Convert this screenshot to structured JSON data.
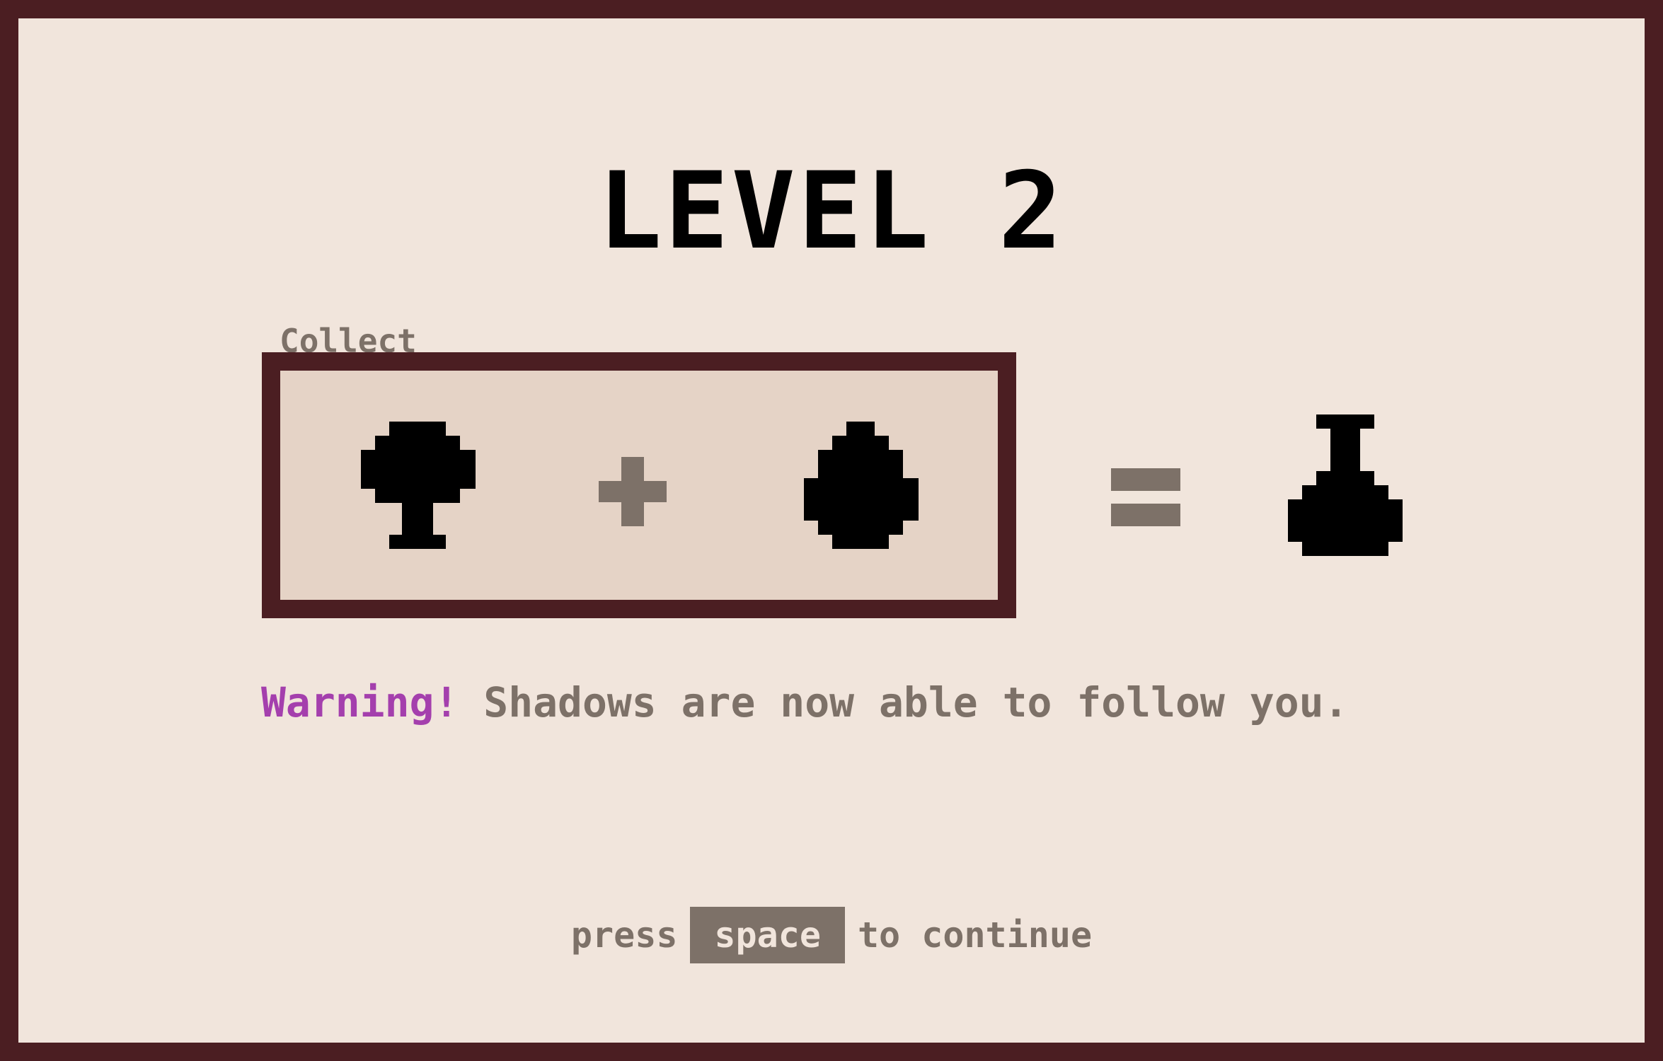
{
  "level": {
    "title": "LEVEL 2"
  },
  "recipe": {
    "label": "Collect",
    "ingredients": [
      "tree-icon",
      "egg-icon"
    ],
    "result": "potion-icon",
    "plus_symbol": "plus-icon",
    "equals_symbol": "equals-icon"
  },
  "warning": {
    "prefix": "Warning!",
    "message": "Shadows are now able to follow you."
  },
  "prompt": {
    "before": "press",
    "key": "space",
    "after": "to continue"
  },
  "colors": {
    "border": "#4b1e22",
    "background": "#f1e5dc",
    "box_fill": "#e5d3c6",
    "muted_text": "#7d7168",
    "warning": "#a43fad",
    "icon": "#000000"
  }
}
